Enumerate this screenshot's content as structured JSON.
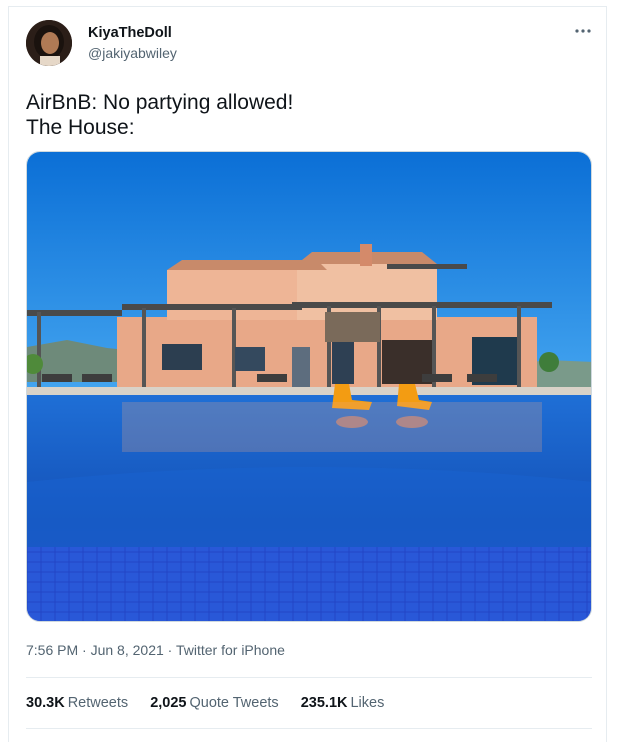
{
  "user": {
    "display_name": "KiyaTheDoll",
    "handle": "@jakiyabwiley"
  },
  "tweet": {
    "lines": [
      "AirBnB: No partying allowed!",
      "The House:"
    ]
  },
  "meta": {
    "time": "7:56 PM",
    "separator": "·",
    "date": "Jun 8, 2021",
    "source": "Twitter for iPhone"
  },
  "stats": [
    {
      "count": "30.3K",
      "label": "Retweets"
    },
    {
      "count": "2,025",
      "label": "Quote Tweets"
    },
    {
      "count": "235.1K",
      "label": "Likes"
    }
  ],
  "icons": {
    "more": "more-horizontal-icon"
  },
  "colors": {
    "text_primary": "#0f1419",
    "text_secondary": "#536471",
    "border": "#e6ecf0",
    "sky": "#1e88e5",
    "pool": "#1565c0"
  }
}
